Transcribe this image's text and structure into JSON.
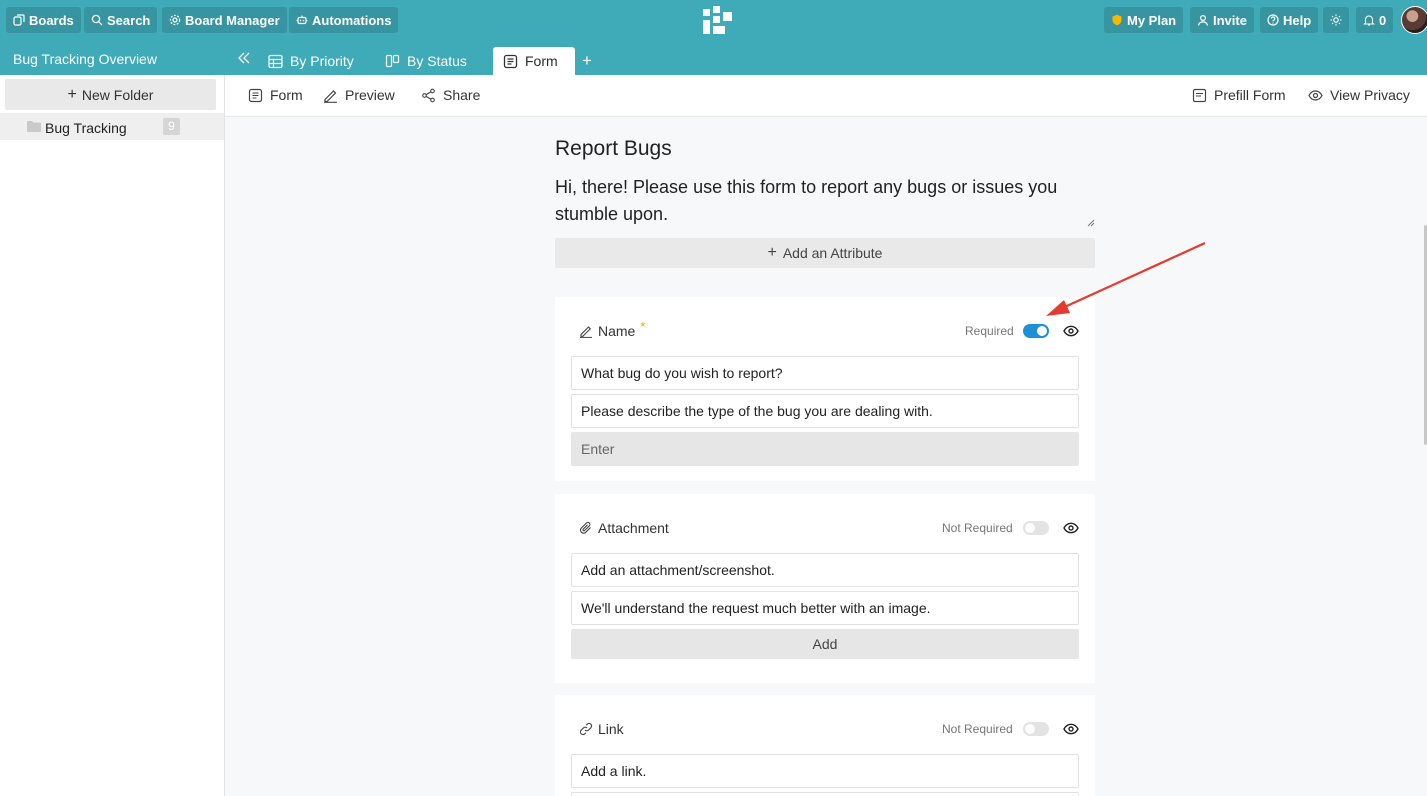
{
  "topbar": {
    "boards": "Boards",
    "search": "Search",
    "board_manager": "Board Manager",
    "automations": "Automations",
    "my_plan": "My Plan",
    "invite": "Invite",
    "help": "Help",
    "notifications_count": "0"
  },
  "tabbar": {
    "board_title": "Bug Tracking Overview",
    "tabs": [
      {
        "label": "By Priority"
      },
      {
        "label": "By Status"
      },
      {
        "label": "Form"
      }
    ],
    "add": "+"
  },
  "sidebar": {
    "new_folder": "New Folder",
    "folders": [
      {
        "label": "Bug Tracking",
        "count": "9"
      }
    ]
  },
  "toolbar": {
    "form": "Form",
    "preview": "Preview",
    "share": "Share",
    "prefill_form": "Prefill Form",
    "view_privacy": "View Privacy"
  },
  "form": {
    "title": "Report Bugs",
    "description": "Hi, there! Please use this form to report any bugs or issues you stumble upon.",
    "add_attribute": "Add an Attribute",
    "fields": [
      {
        "label": "Name",
        "required": true,
        "required_label": "Required",
        "question": "What bug do you wish to report?",
        "help": "Please describe the type of the bug you are dealing with.",
        "input_placeholder": "Enter"
      },
      {
        "label": "Attachment",
        "required": false,
        "required_label": "Not Required",
        "question": "Add an attachment/screenshot.",
        "help": "We'll understand the request much better with an image.",
        "button": "Add"
      },
      {
        "label": "Link",
        "required": false,
        "required_label": "Not Required",
        "question": "Add a link."
      }
    ]
  },
  "colors": {
    "brand": "#3faab8",
    "toggle_on": "#1e90d6",
    "annotation_arrow": "#e53a2f",
    "plan_shield": "#f5b800"
  }
}
